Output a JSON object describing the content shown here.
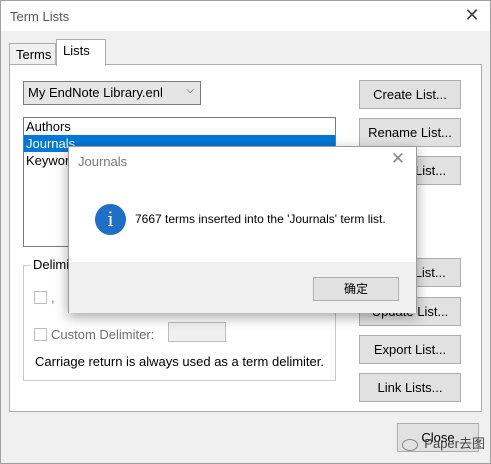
{
  "window": {
    "title": "Term Lists",
    "close_glyph": "✕"
  },
  "tabs": [
    {
      "label": "Terms"
    },
    {
      "label": "Lists"
    }
  ],
  "library_select": {
    "value": "My EndNote Library.enl",
    "chevron": "⌵"
  },
  "lists": [
    {
      "label": "Authors",
      "selected": false
    },
    {
      "label": "Journals",
      "selected": true
    },
    {
      "label": "Keywords",
      "selected": false
    }
  ],
  "delimiters": {
    "group_label": "Delimiters",
    "comma_label": ",",
    "custom_label": "Custom Delimiter:",
    "custom_value": "",
    "note": "Carriage return is always used as a term delimiter."
  },
  "buttons": {
    "create": "Create List...",
    "rename": "Rename List...",
    "delete": "Delete List...",
    "import": "Import List...",
    "update": "Update List...",
    "export": "Export List...",
    "link": "Link Lists...",
    "close": "Close"
  },
  "message_box": {
    "title": "Journals",
    "close_glyph": "✕",
    "icon": "info-icon",
    "icon_glyph": "i",
    "text": "7667 terms inserted into the 'Journals' term list.",
    "ok_label": "确定"
  },
  "watermark": {
    "text": "Paper去图"
  },
  "colors": {
    "selection": "#0078d7",
    "info_icon": "#1e6fc8",
    "window_bg": "#f0f0f0"
  }
}
